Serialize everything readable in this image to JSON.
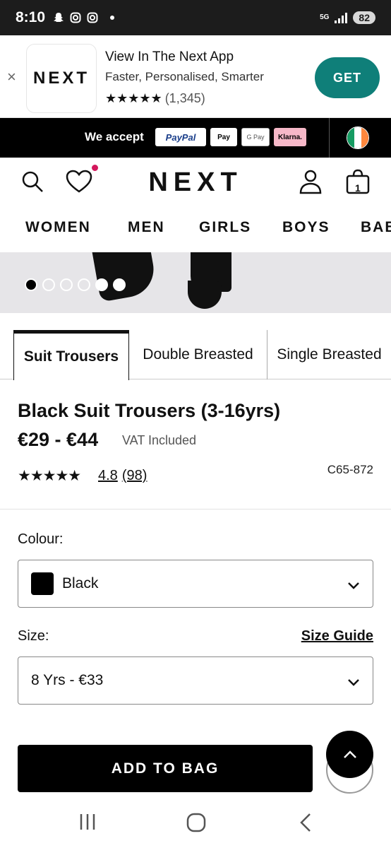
{
  "status_bar": {
    "time": "8:10",
    "network": "5G",
    "battery": "82"
  },
  "app_banner": {
    "close": "×",
    "logo": "NEXT",
    "title": "View In The Next App",
    "subtitle": "Faster, Personalised, Smarter",
    "stars": "★★★★★",
    "rating_count": "(1,345)",
    "get_label": "GET"
  },
  "payment_bar": {
    "we_accept": "We accept",
    "methods": [
      "PayPal",
      "Pay",
      "G Pay",
      "Klarna."
    ]
  },
  "header": {
    "brand": "NEXT",
    "bag_count": "1"
  },
  "nav": {
    "items": [
      "WOMEN",
      "MEN",
      "GIRLS",
      "BOYS",
      "BABY"
    ]
  },
  "tabs": [
    "Suit Trousers",
    "Double Breasted",
    "Single Breasted"
  ],
  "product": {
    "title": "Black Suit Trousers (3-16yrs)",
    "price": "€29 - €44",
    "vat": "VAT Included",
    "stars": "★★★★★",
    "rating": "4.8",
    "review_count": "(98)",
    "code": "C65-872"
  },
  "colour": {
    "label": "Colour:",
    "value": "Black",
    "swatch_color": "#000000"
  },
  "size": {
    "label": "Size:",
    "guide_label": "Size Guide",
    "value": "8 Yrs - €33"
  },
  "add_to_bag": "ADD TO BAG",
  "colors": {
    "get_button": "#0f7f79",
    "wishlist_dot": "#d3175c"
  }
}
